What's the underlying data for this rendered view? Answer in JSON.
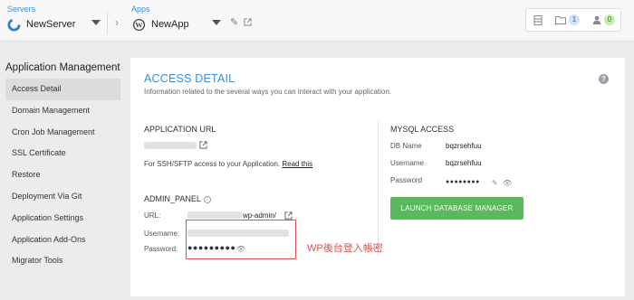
{
  "topbar": {
    "servers_label": "Servers",
    "server_name": "NewServer",
    "apps_label": "Apps",
    "app_name": "NewApp",
    "badge_folders": "1",
    "badge_users": "0"
  },
  "sidebar": {
    "title": "Application Management",
    "items": [
      "Access Detail",
      "Domain Management",
      "Cron Job Management",
      "SSL Certificate",
      "Restore",
      "Deployment Via Git",
      "Application Settings",
      "Application Add-Ons",
      "Migrator Tools"
    ]
  },
  "access": {
    "title": "ACCESS DETAIL",
    "subtitle": "Information related to the several ways you can interact with your application.",
    "app_url_heading": "APPLICATION URL",
    "ssh_text": "For SSH/SFTP access to your Application.",
    "read_this": "Read this",
    "admin_heading": "ADMIN_PANEL",
    "url_label": "URL:",
    "url_suffix": "wp-admin/",
    "username_label": "Username:",
    "password_label": "Password:",
    "password_dots": "●●●●●●●●●",
    "mysql_heading": "MYSQL ACCESS",
    "db_name_label": "DB Name",
    "db_name_value": "bqzrsehfuu",
    "db_user_label": "Username",
    "db_user_value": "bqzrsehfuu",
    "db_pass_label": "Password",
    "db_pass_dots": "●●●●●●●●",
    "launch_button": "LAUNCH DATABASE MANAGER"
  },
  "annotation": {
    "text": "WP後台登入帳密",
    "color": "#d9534f"
  },
  "colors": {
    "accent": "#3a8fd6",
    "button_green": "#5cb85c"
  }
}
